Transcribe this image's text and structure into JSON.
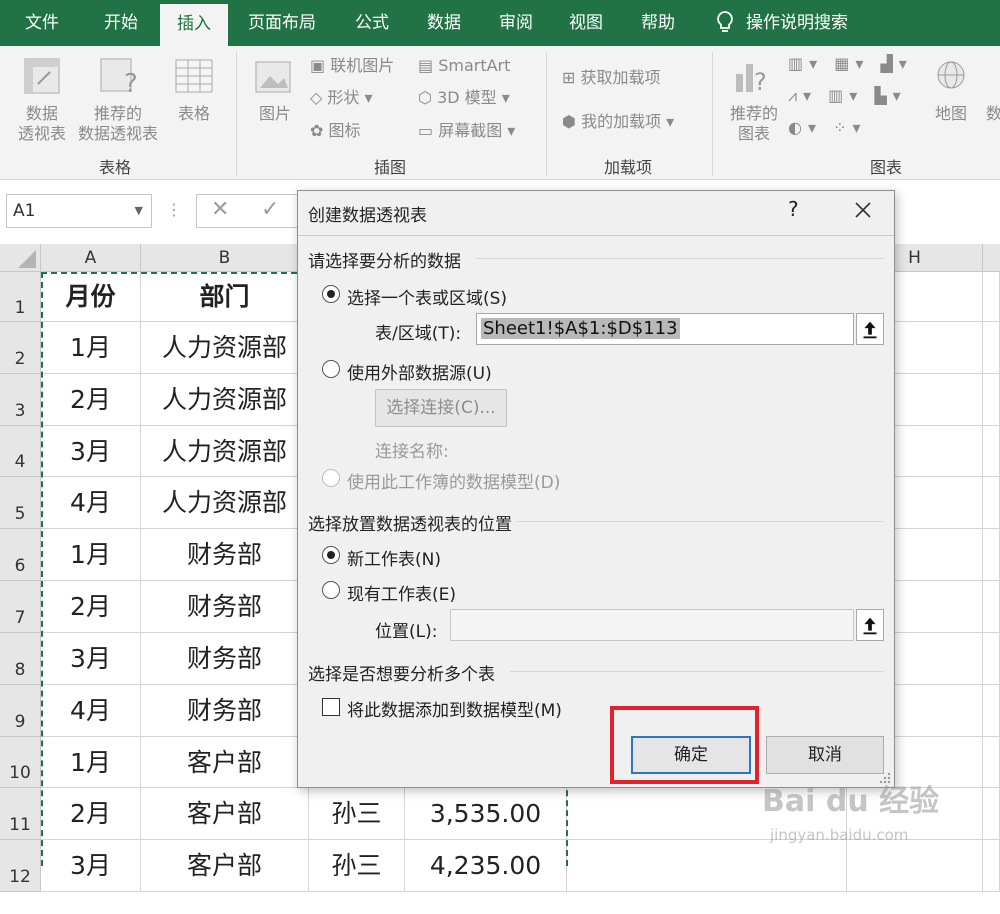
{
  "ribbon_tabs": [
    "文件",
    "开始",
    "插入",
    "页面布局",
    "公式",
    "数据",
    "审阅",
    "视图",
    "帮助"
  ],
  "search_label": "操作说明搜索",
  "ribbon": {
    "pivot_table": [
      "数据",
      "透视表"
    ],
    "recommended_pivot": [
      "推荐的",
      "数据透视表"
    ],
    "table": "表格",
    "group_tables": "表格",
    "picture": "图片",
    "online_picture": "联机图片",
    "shapes": "形状",
    "icons": "图标",
    "smartart": "SmartArt",
    "model_3d": "3D 模型",
    "screenshot": "屏幕截图",
    "group_illustrations": "插图",
    "get_addins": "获取加载项",
    "my_addins": "我的加载项",
    "group_addins": "加载项",
    "recommended_charts": [
      "推荐的",
      "图表"
    ],
    "map": "地图",
    "group_charts": "图表",
    "cut_label": "数"
  },
  "name_box": "A1",
  "columns": [
    "A",
    "B",
    "H"
  ],
  "rows": [
    {
      "num": "1",
      "a": "月份",
      "b": "部门"
    },
    {
      "num": "2",
      "a": "1月",
      "b": "人力资源部"
    },
    {
      "num": "3",
      "a": "2月",
      "b": "人力资源部"
    },
    {
      "num": "4",
      "a": "3月",
      "b": "人力资源部"
    },
    {
      "num": "5",
      "a": "4月",
      "b": "人力资源部"
    },
    {
      "num": "6",
      "a": "1月",
      "b": "财务部"
    },
    {
      "num": "7",
      "a": "2月",
      "b": "财务部"
    },
    {
      "num": "8",
      "a": "3月",
      "b": "财务部"
    },
    {
      "num": "9",
      "a": "4月",
      "b": "财务部"
    },
    {
      "num": "10",
      "a": "1月",
      "b": "客户部"
    },
    {
      "num": "11",
      "a": "2月",
      "b": "客户部",
      "c": "孙三",
      "d": "3,535.00"
    },
    {
      "num": "12",
      "a": "3月",
      "b": "客户部",
      "c": "孙三",
      "d": "4,235.00"
    }
  ],
  "dialog": {
    "title": "创建数据透视表",
    "help": "?",
    "section_choose": "请选择要分析的数据",
    "opt_select_range": "选择一个表或区域(S)",
    "range_label": "表/区域(T):",
    "range_value": "Sheet1!$A$1:$D$113",
    "opt_external": "使用外部数据源(U)",
    "choose_connection": "选择连接(C)...",
    "connection_name": "连接名称:",
    "opt_data_model": "使用此工作簿的数据模型(D)",
    "section_location": "选择放置数据透视表的位置",
    "opt_new_sheet": "新工作表(N)",
    "opt_existing_sheet": "现有工作表(E)",
    "location_label": "位置(L):",
    "location_value": "",
    "section_multi": "选择是否想要分析多个表",
    "add_to_model": "将此数据添加到数据模型(M)",
    "ok": "确定",
    "cancel": "取消"
  },
  "watermark": {
    "main": "Bai du 经验",
    "sub": "jingyan.baidu.com"
  }
}
